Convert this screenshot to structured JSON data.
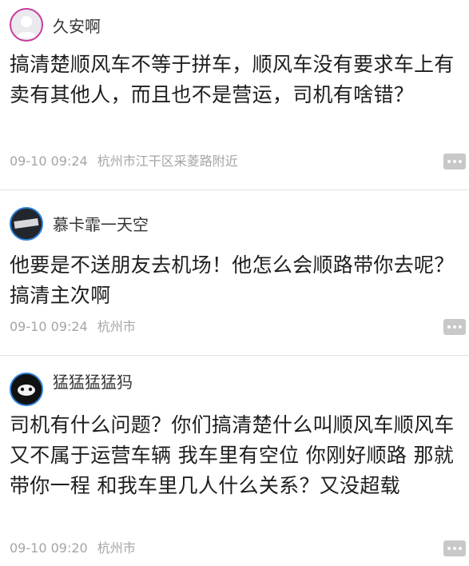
{
  "comments": [
    {
      "username": "久安啊",
      "text": "搞清楚顺风车不等于拼车，顺风车没有要求车上有卖有其他人，而且也不是营运，司机有啥错？",
      "time": "09-10 09:24",
      "location": "杭州市江干区采菱路附近",
      "avatar_icon": "user-avatar-icon"
    },
    {
      "username": "慕卡霏一天空",
      "text": "他要是不送朋友去机场！他怎么会顺路带你去呢？搞清主次啊",
      "time": "09-10 09:24",
      "location": "杭州市",
      "avatar_icon": "user-avatar-icon"
    },
    {
      "username": "猛猛猛猛犸",
      "text": "司机有什么问题？你们搞清楚什么叫顺风车顺风车又不属于运营车辆 我车里有空位 你刚好顺路 那就带你一程 和我车里几人什么关系？又没超载",
      "time": "09-10 09:20",
      "location": "杭州市",
      "avatar_icon": "user-avatar-icon"
    }
  ],
  "colors": {
    "text": "#1e1e1e",
    "meta": "#a5a5a5",
    "divider": "#e2e2e2",
    "avatar_ring_1": "#c93c9a",
    "avatar_ring_2": "#2b7fd6"
  }
}
